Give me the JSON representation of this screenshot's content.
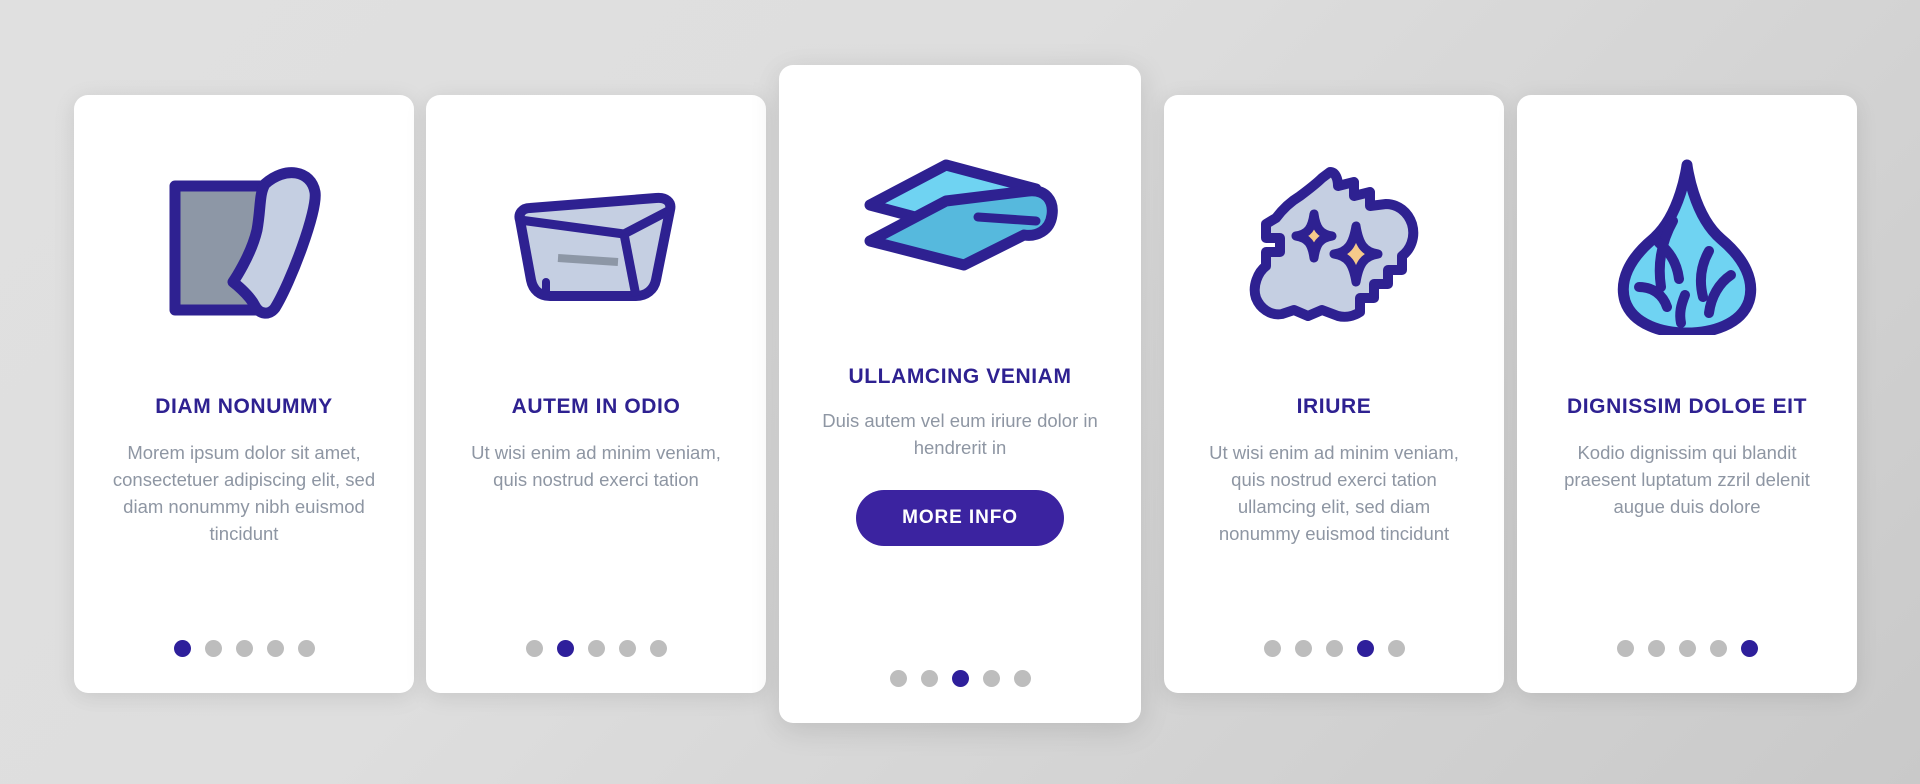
{
  "theme": {
    "background_start": "#e0e0e0",
    "background_end": "#c9c9c9",
    "card_background": "#ffffff",
    "title_color": "#2e2191",
    "body_color": "#8e96a3",
    "accent_color": "#3b23a0",
    "dot_inactive_color": "#bdbdbd",
    "dot_active_color": "#2e1f9b",
    "icon_stroke": "#2e2191",
    "icon_fill_gray": "#8d97a6",
    "icon_fill_light": "#c5cfe2",
    "icon_fill_cyan": "#6fd3f2",
    "icon_fill_cyan_dark": "#56b9dd",
    "icon_fill_sparkle": "#f6c98a"
  },
  "cards": [
    {
      "id": "card-1",
      "icon": "cloth-folded-corner-icon",
      "title": "DIAM NONUMMY",
      "body": "Morem ipsum dolor sit amet, consectetuer adipiscing elit, sed diam nonummy nibh euismod tincidunt",
      "dots": 5,
      "active_dot": 1,
      "has_cta": false
    },
    {
      "id": "card-2",
      "icon": "wash-basin-tray-icon",
      "title": "AUTEM IN ODIO",
      "body": "Ut wisi enim ad minim veniam, quis nostrud exerci tation",
      "dots": 5,
      "active_dot": 2,
      "has_cta": false
    },
    {
      "id": "card-3",
      "icon": "folded-towel-icon",
      "title": "ULLAMCING VENIAM",
      "body": "Duis autem vel eum iriure dolor in hendrerit in",
      "dots": 5,
      "active_dot": 3,
      "has_cta": true,
      "cta_label": "MORE INFO"
    },
    {
      "id": "card-4",
      "icon": "cleaning-cloth-sparkle-icon",
      "title": "IRIURE",
      "body": "Ut wisi enim ad minim veniam, quis nostrud exerci tation ullamcing elit, sed diam nonummy euismod tincidunt",
      "dots": 5,
      "active_dot": 4,
      "has_cta": false
    },
    {
      "id": "card-5",
      "icon": "wrung-cloth-droplet-icon",
      "title": "DIGNISSIM DOLOE EIT",
      "body": "Kodio dignissim qui blandit praesent luptatum zzril delenit augue duis dolore",
      "dots": 5,
      "active_dot": 5,
      "has_cta": false
    }
  ]
}
